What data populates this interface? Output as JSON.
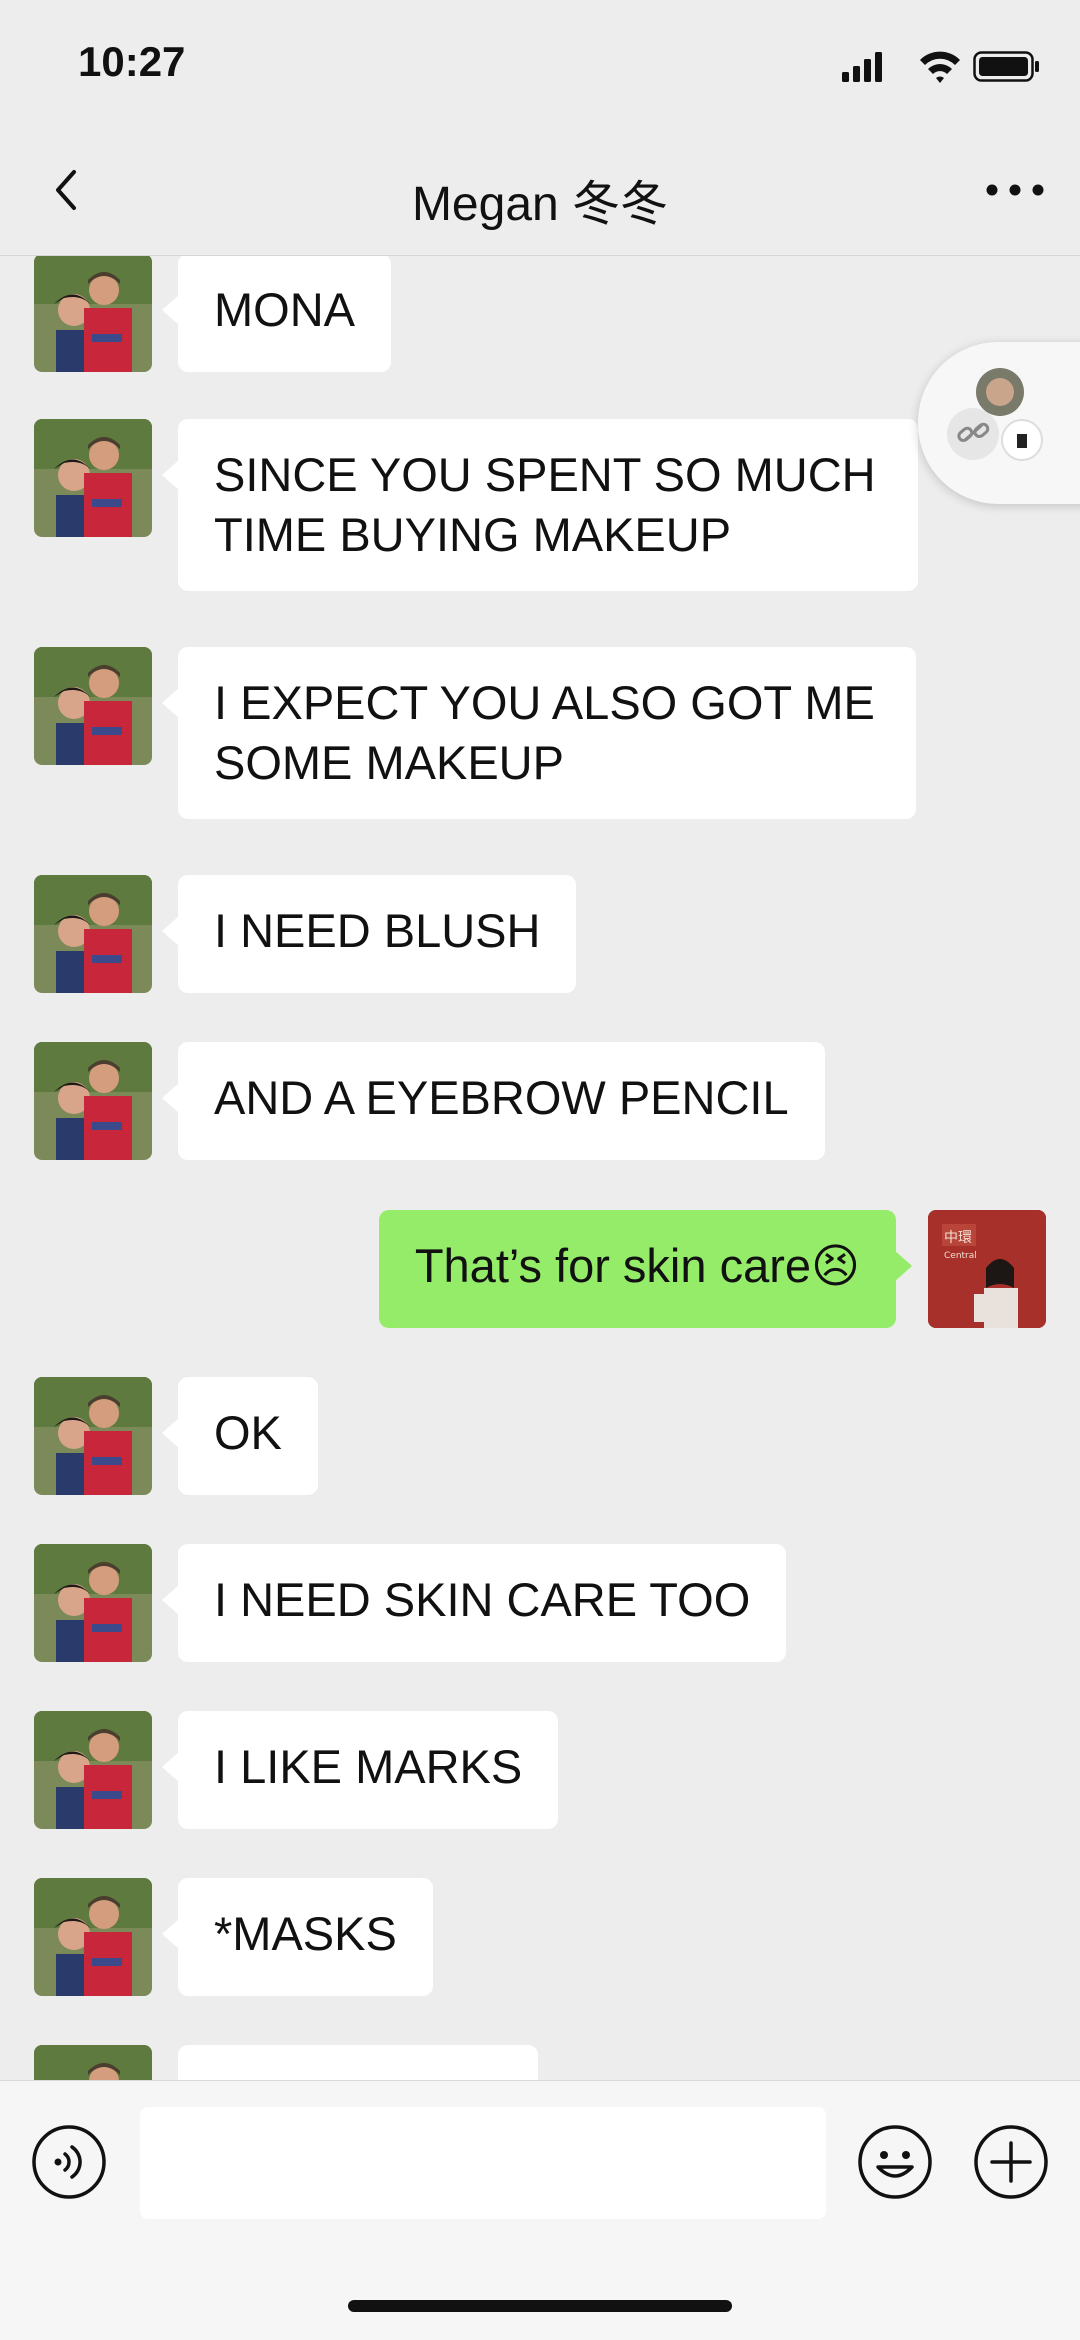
{
  "status_bar": {
    "time": "10:27"
  },
  "header": {
    "title": "Megan 冬冬"
  },
  "messages": [
    {
      "side": "left",
      "text": "MONA"
    },
    {
      "side": "left",
      "text": "SINCE YOU SPENT SO MUCH TIME BUYING MAKEUP"
    },
    {
      "side": "left",
      "text": "I EXPECT YOU ALSO GOT ME SOME MAKEUP"
    },
    {
      "side": "left",
      "text": "I NEED BLUSH"
    },
    {
      "side": "left",
      "text": "AND A EYEBROW PENCIL"
    },
    {
      "side": "right",
      "text": "That’s for skin care😣"
    },
    {
      "side": "left",
      "text": "OK"
    },
    {
      "side": "left",
      "text": "I NEED SKIN CARE TOO"
    },
    {
      "side": "left",
      "text": "I LIKE MARKS"
    },
    {
      "side": "left",
      "text": "*MASKS"
    },
    {
      "side": "left",
      "text": ""
    }
  ],
  "input": {
    "placeholder": ""
  },
  "icons": {
    "back": "chevron-left-icon",
    "more": "more-dots-icon",
    "voice": "voice-icon",
    "emoji": "emoji-icon",
    "plus": "plus-icon"
  },
  "colors": {
    "background": "#ededed",
    "incoming_bubble": "#ffffff",
    "outgoing_bubble": "#95ec69"
  }
}
